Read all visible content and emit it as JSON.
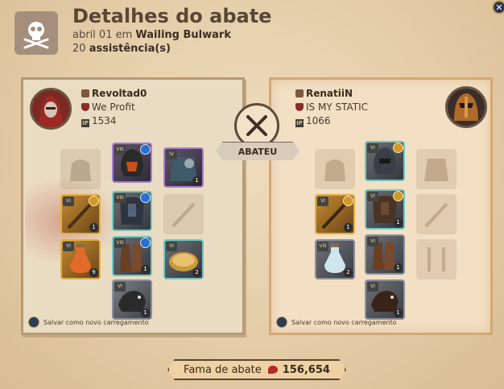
{
  "header": {
    "title": "Detalhes do abate",
    "date_text": "abril 01 em",
    "location": "Wailing Bulwark",
    "assists_count": "20",
    "assists_label": "assistência(s)"
  },
  "killer": {
    "name": "Revoltad0",
    "guild": "We Profit",
    "item_power": "1534",
    "save_label": "Salvar como novo carregamento",
    "slots": [
      {
        "slot": "bag",
        "state": "empty"
      },
      {
        "slot": "head",
        "state": "item",
        "tier": "VIII",
        "border": "purple"
      },
      {
        "slot": "cape",
        "state": "item",
        "tier": "IV",
        "border": "purple",
        "qty": "1"
      },
      {
        "slot": "main-hand",
        "state": "item",
        "tier": "VI",
        "border": "gold",
        "qty": "1"
      },
      {
        "slot": "chest",
        "state": "item",
        "tier": "VIII",
        "border": "teal"
      },
      {
        "slot": "off-hand",
        "state": "empty"
      },
      {
        "slot": "potion",
        "state": "item",
        "tier": "VI",
        "border": "gold",
        "qty": "9"
      },
      {
        "slot": "boots",
        "state": "item",
        "tier": "VIII",
        "border": "teal",
        "qty": "1"
      },
      {
        "slot": "food",
        "state": "item",
        "tier": "VI",
        "border": "teal",
        "qty": "2"
      },
      {
        "slot": "mount",
        "state": "item",
        "tier": "VI",
        "border": "default",
        "qty": "1"
      }
    ]
  },
  "victim": {
    "name": "RenatiiN",
    "guild": "IS MY STATIC",
    "item_power": "1066",
    "save_label": "Salvar como novo carregamento",
    "slots": [
      {
        "slot": "bag",
        "state": "empty"
      },
      {
        "slot": "head",
        "state": "item",
        "tier": "VI",
        "border": "teal"
      },
      {
        "slot": "cape",
        "state": "empty"
      },
      {
        "slot": "main-hand",
        "state": "item",
        "tier": "VI",
        "border": "gold",
        "qty": "1"
      },
      {
        "slot": "chest",
        "state": "item",
        "tier": "VI",
        "border": "teal",
        "qty": "1"
      },
      {
        "slot": "off-hand",
        "state": "empty"
      },
      {
        "slot": "potion",
        "state": "item",
        "tier": "VIII",
        "border": "default",
        "qty": "2"
      },
      {
        "slot": "boots",
        "state": "item",
        "tier": "VI",
        "border": "default",
        "qty": "1"
      },
      {
        "slot": "food",
        "state": "empty"
      },
      {
        "slot": "mount",
        "state": "item",
        "tier": "VI",
        "border": "default",
        "qty": "1"
      }
    ]
  },
  "kill_label": "ABATEU",
  "fame": {
    "label": "Fama de abate",
    "value": "156,654"
  },
  "icons": {
    "header": "skull-crossbones-icon",
    "center": "crossed-swords-icon",
    "close": "close-icon"
  }
}
